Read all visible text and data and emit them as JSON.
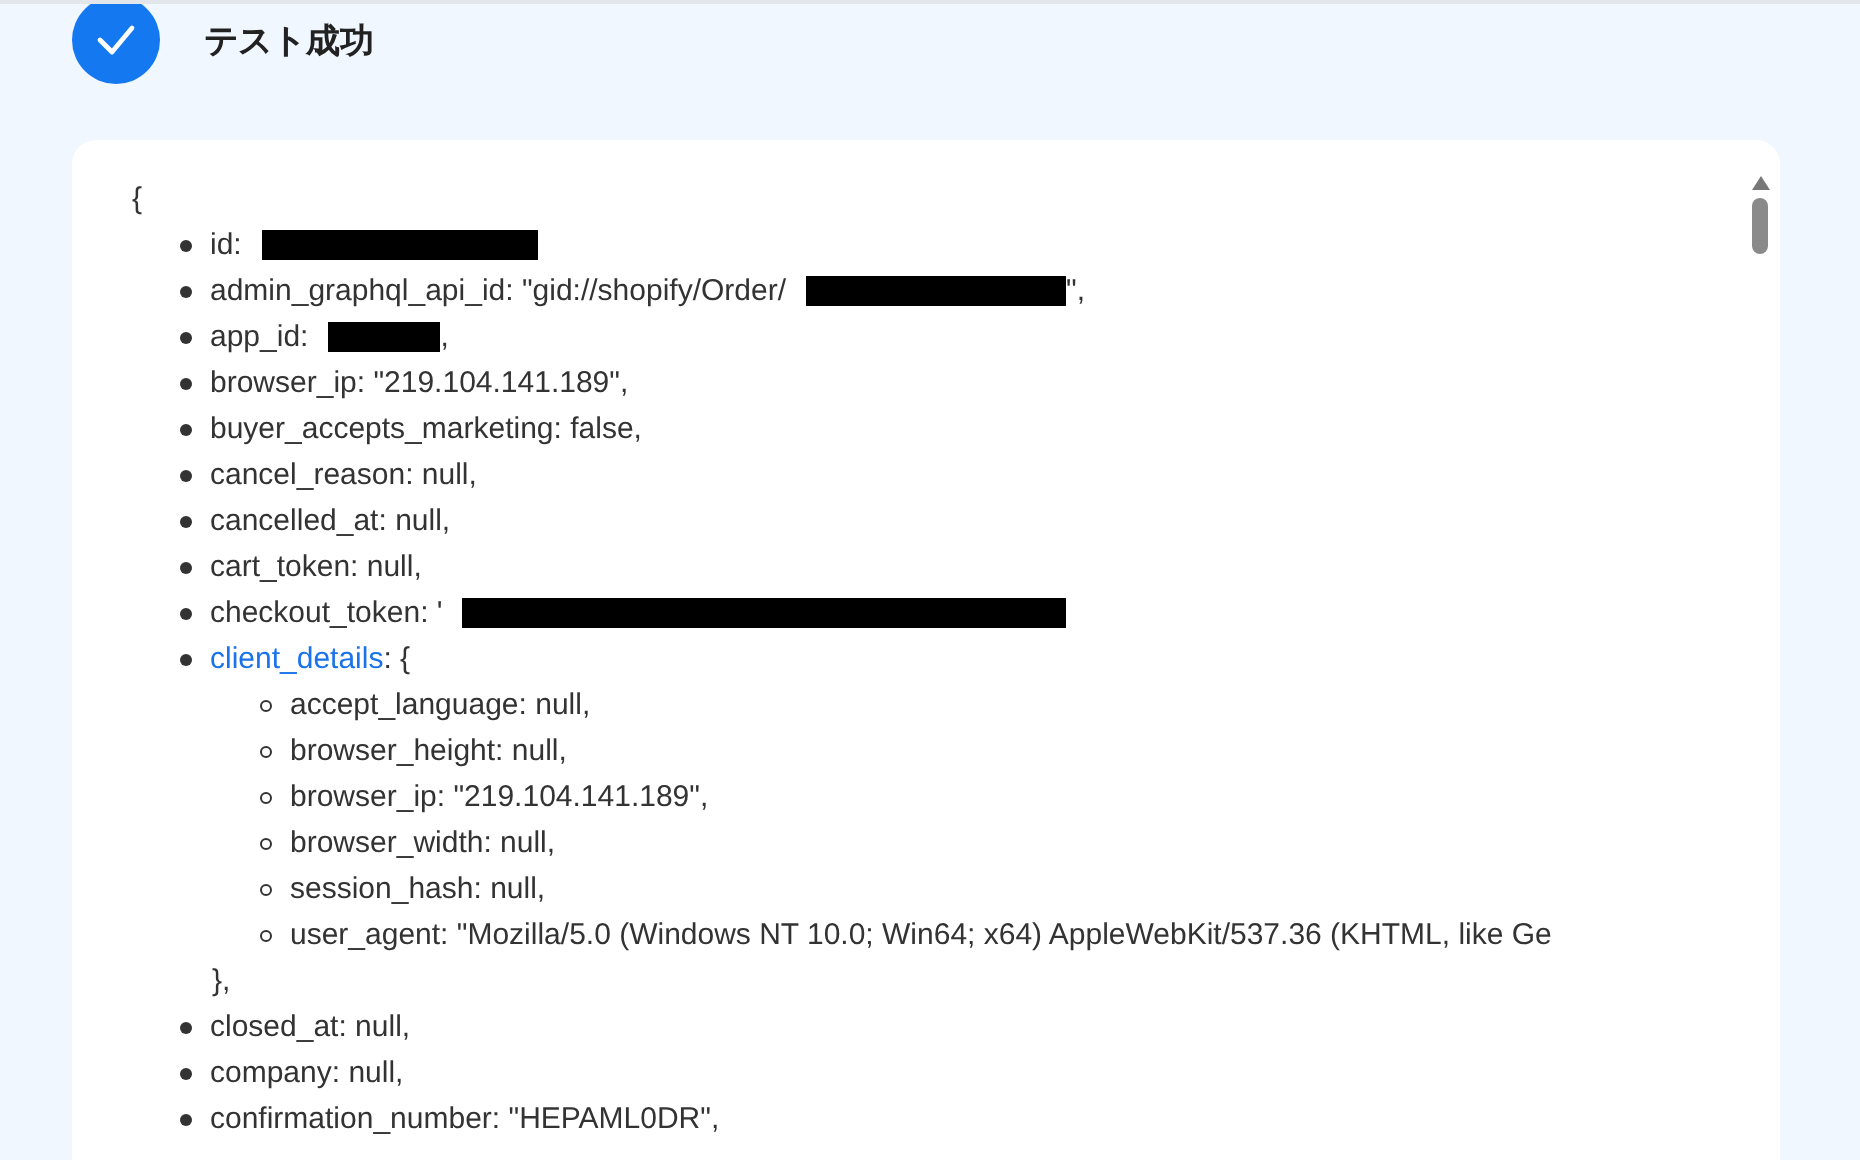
{
  "header": {
    "title": "テスト成功",
    "kind": "success"
  },
  "json_view": {
    "open_brace": "{",
    "rows": [
      {
        "text": "id:",
        "redacted": true
      },
      {
        "text": "admin_graphql_api_id: \"gid://shopify/Order/",
        "redacted": true,
        "after": "\","
      },
      {
        "text": "app_id:",
        "redacted": true,
        "after": ","
      },
      {
        "text": "browser_ip: \"219.104.141.189\","
      },
      {
        "text": "buyer_accepts_marketing: false,"
      },
      {
        "text": "cancel_reason: null,"
      },
      {
        "text": "cancelled_at: null,"
      },
      {
        "text": "cart_token: null,"
      },
      {
        "text": "checkout_token: '",
        "redacted": true
      },
      {
        "link": "client_details",
        "text": ": {",
        "close": "},",
        "children": [
          {
            "text": "accept_language: null,"
          },
          {
            "text": "browser_height: null,"
          },
          {
            "text": "browser_ip: \"219.104.141.189\","
          },
          {
            "text": "browser_width: null,"
          },
          {
            "text": "session_hash: null,"
          },
          {
            "text": "user_agent: \"Mozilla/5.0 (Windows NT 10.0; Win64; x64) AppleWebKit/537.36 (KHTML, like Ge"
          }
        ]
      },
      {
        "text": "closed_at: null,"
      },
      {
        "text": "company: null,"
      },
      {
        "text": "confirmation_number: \"HEPAML0DR\","
      }
    ]
  }
}
